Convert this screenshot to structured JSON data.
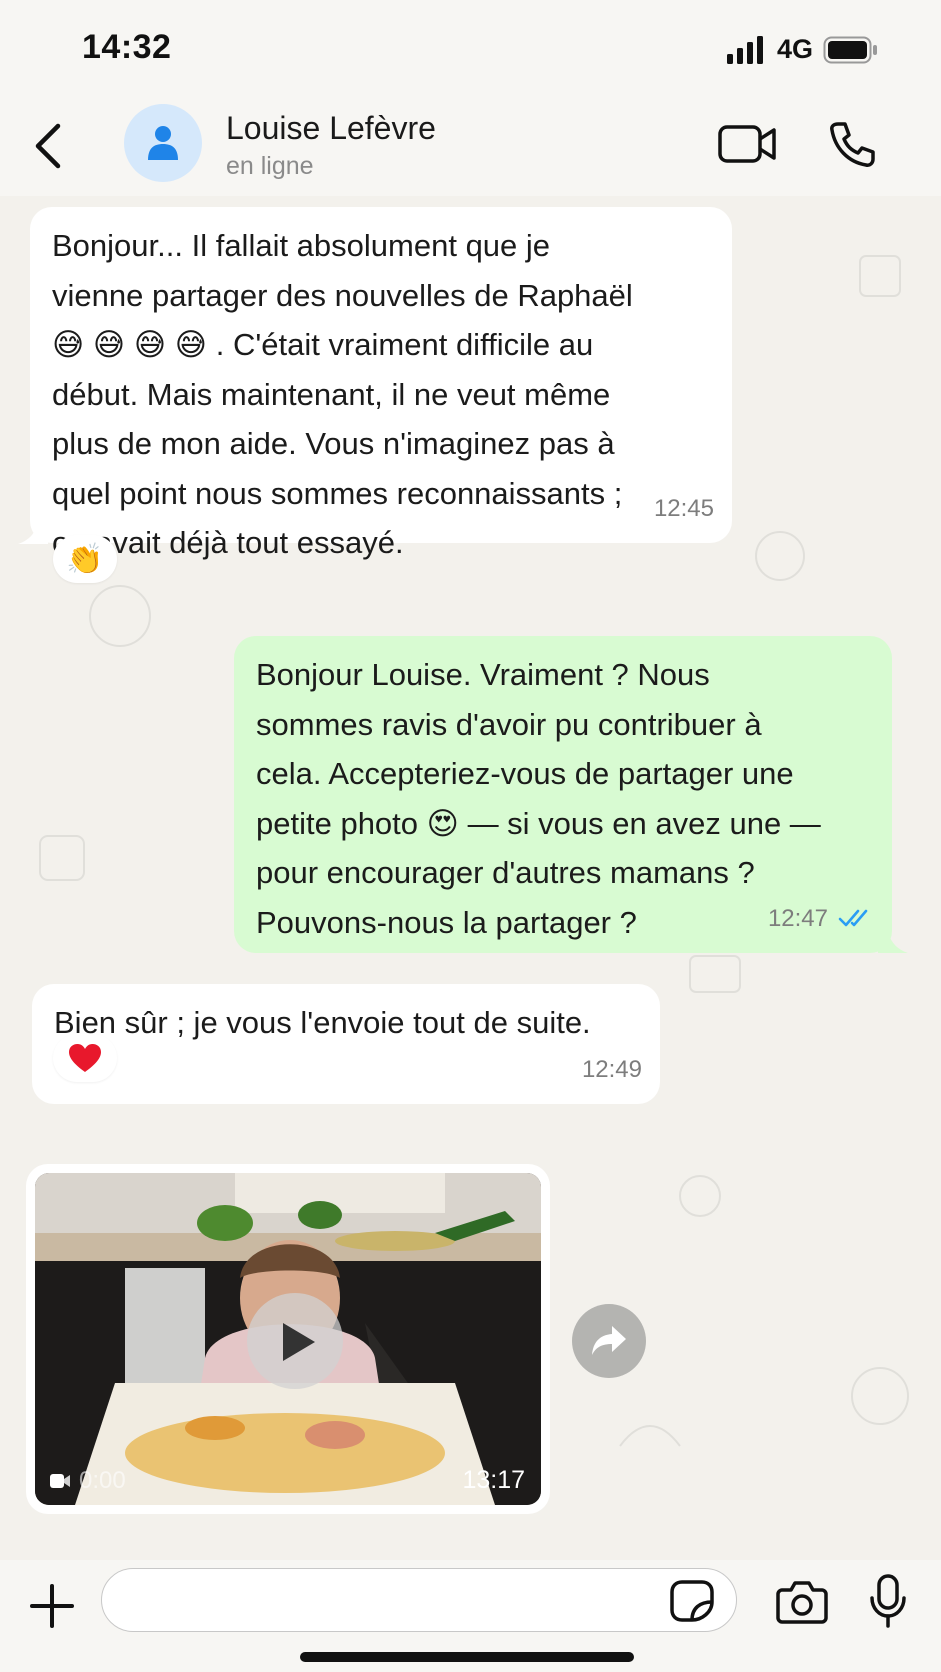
{
  "status_bar": {
    "time": "14:32",
    "network": "4G"
  },
  "header": {
    "name": "Louise Lefèvre",
    "status": "en ligne"
  },
  "messages": [
    {
      "direction": "in",
      "lines": [
        "Bonjour... Il fallait absolument que je",
        "vienne partager des nouvelles de Raphaël",
        "😅 😅 😅 😅 . C'était vraiment difficile au",
        "début. Mais maintenant, il ne veut même",
        "plus de mon aide. Vous n'imaginez pas à",
        "quel point nous sommes reconnaissants ;",
        "on avait déjà tout essayé."
      ],
      "time": "12:45",
      "reaction": "👏"
    },
    {
      "direction": "out",
      "lines": [
        "Bonjour Louise. Vraiment ? Nous",
        "sommes ravis d'avoir pu contribuer à",
        "cela. Accepteriez-vous de partager une",
        "petite photo 😍 — si vous en avez une —",
        "pour encourager d'autres mamans ?",
        "Pouvons-nous la partager ?"
      ],
      "time": "12:47",
      "read": true
    },
    {
      "direction": "in",
      "lines": [
        "Bien sûr ; je vous l'envoie tout de suite."
      ],
      "time": "12:49",
      "reaction": "❤️"
    },
    {
      "direction": "in",
      "type": "video",
      "duration": "0:00",
      "time": "13:17"
    }
  ],
  "composer": {
    "placeholder": ""
  },
  "colors": {
    "incoming": "#ffffff",
    "outgoing": "#d8fbd2",
    "background": "#f3f1ec",
    "read_tick": "#2a9df4"
  }
}
